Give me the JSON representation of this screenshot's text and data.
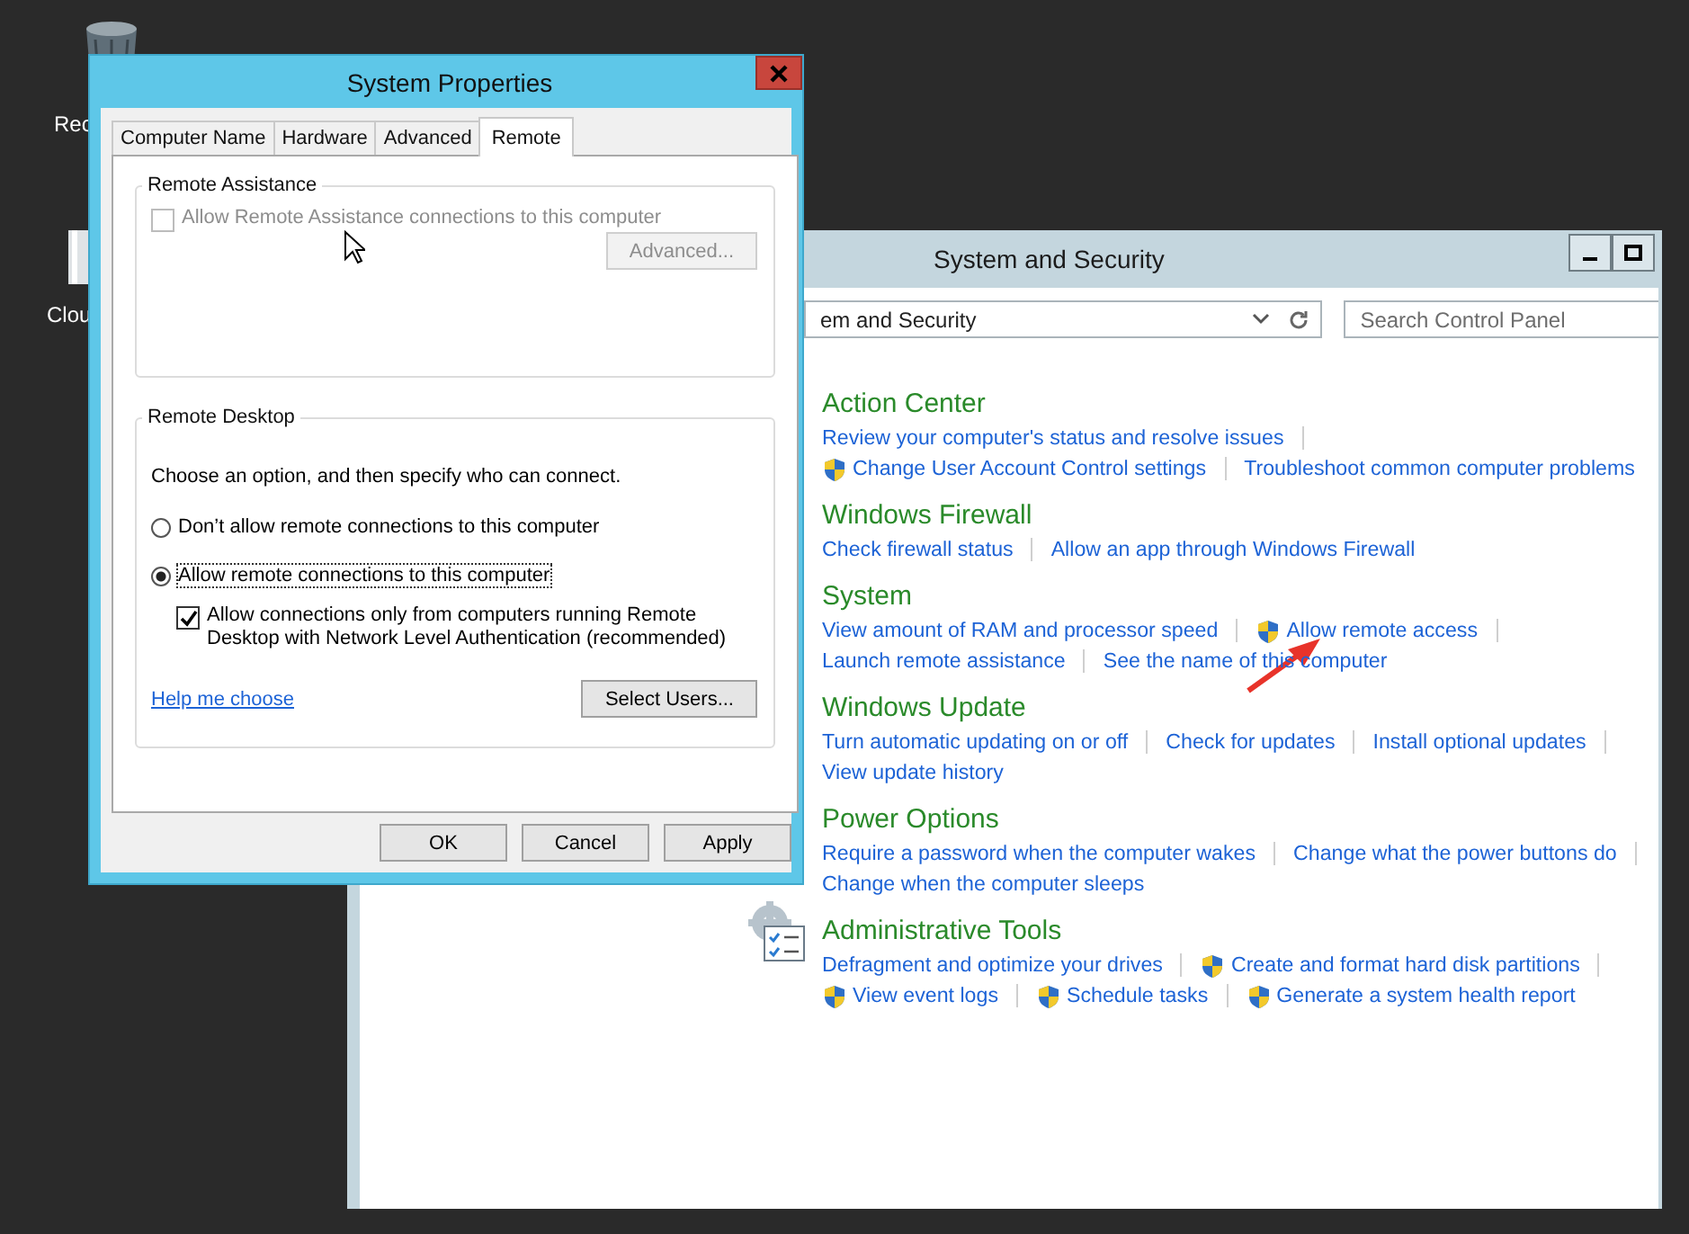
{
  "desktop_icons": [
    {
      "kind": "recycle-bin",
      "label": "Rec"
    },
    {
      "kind": "cloud",
      "label": "Clou"
    }
  ],
  "control_panel": {
    "title": "System and Security",
    "address": "em and Security",
    "search_placeholder": "Search Control Panel",
    "sections": [
      {
        "title": "Action Center",
        "links": [
          {
            "text": "Review your computer's status and resolve issues",
            "shield": false
          },
          {
            "text": "Change User Account Control settings",
            "shield": true
          },
          {
            "text": "Troubleshoot common computer problems",
            "shield": false
          }
        ]
      },
      {
        "title": "Windows Firewall",
        "links": [
          {
            "text": "Check firewall status",
            "shield": false
          },
          {
            "text": "Allow an app through Windows Firewall",
            "shield": false
          }
        ]
      },
      {
        "title": "System",
        "links": [
          {
            "text": "View amount of RAM and processor speed",
            "shield": false
          },
          {
            "text": "Allow remote access",
            "shield": true
          },
          {
            "text": "Launch remote assistance",
            "shield": false
          },
          {
            "text": "See the name of this computer",
            "shield": false
          }
        ]
      },
      {
        "title": "Windows Update",
        "links": [
          {
            "text": "Turn automatic updating on or off",
            "shield": false
          },
          {
            "text": "Check for updates",
            "shield": false
          },
          {
            "text": "Install optional updates",
            "shield": false
          },
          {
            "text": "View update history",
            "shield": false
          }
        ]
      },
      {
        "title": "Power Options",
        "links": [
          {
            "text": "Require a password when the computer wakes",
            "shield": false
          },
          {
            "text": "Change what the power buttons do",
            "shield": false
          },
          {
            "text": "Change when the computer sleeps",
            "shield": false
          }
        ]
      },
      {
        "title": "Administrative Tools",
        "has_icon": true,
        "links": [
          {
            "text": "Defragment and optimize your drives",
            "shield": false
          },
          {
            "text": "Create and format hard disk partitions",
            "shield": true
          },
          {
            "text": "View event logs",
            "shield": true
          },
          {
            "text": "Schedule tasks",
            "shield": true
          },
          {
            "text": "Generate a system health report",
            "shield": true
          }
        ]
      }
    ]
  },
  "dialog": {
    "title": "System Properties",
    "tabs": [
      {
        "label": "Computer Name",
        "selected": false
      },
      {
        "label": "Hardware",
        "selected": false
      },
      {
        "label": "Advanced",
        "selected": false
      },
      {
        "label": "Remote",
        "selected": true
      }
    ],
    "remote_assistance": {
      "title": "Remote Assistance",
      "checkbox": {
        "label": "Allow Remote Assistance connections to this computer",
        "checked": false,
        "disabled": true
      },
      "advanced_button": {
        "label": "Advanced...",
        "disabled": true
      }
    },
    "remote_desktop": {
      "title": "Remote Desktop",
      "intro": "Choose an option, and then specify who can connect.",
      "options": [
        {
          "label": "Don’t allow remote connections to this computer",
          "selected": false
        },
        {
          "label": "Allow remote connections to this computer",
          "selected": true
        }
      ],
      "nla_checkbox": {
        "label": "Allow connections only from computers running Remote Desktop with Network Level Authentication (recommended)",
        "checked": true
      },
      "help_link": "Help me choose",
      "select_users_button": "Select Users..."
    },
    "buttons": [
      "OK",
      "Cancel",
      "Apply"
    ]
  }
}
